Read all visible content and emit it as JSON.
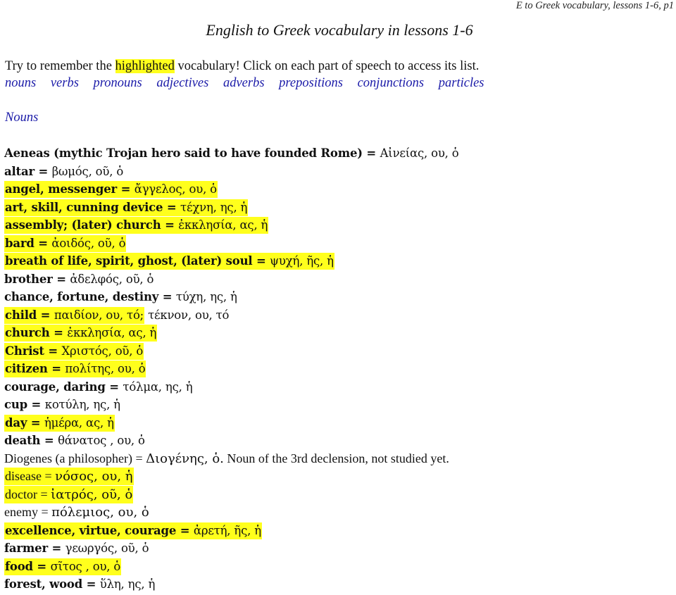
{
  "running_header": "E to Greek vocabulary,  lessons 1-6, p1",
  "title": "English to Greek vocabulary in lessons 1-6",
  "intro": {
    "before": "Try to remember the ",
    "highlighted": "highlighted",
    "after": " vocabulary!  Click on each part of speech to access its list."
  },
  "parts_of_speech": [
    {
      "label": "nouns"
    },
    {
      "label": "verbs"
    },
    {
      "label": "pronouns"
    },
    {
      "label": "adjectives"
    },
    {
      "label": "adverbs"
    },
    {
      "label": "prepositions"
    },
    {
      "label": "conjunctions"
    },
    {
      "label": "particles"
    }
  ],
  "section_heading": "Nouns",
  "highlight_color": "#ffff1c",
  "link_color": "#1a1aa8",
  "entries": [
    {
      "english": "Aeneas (mythic Trojan hero said to have founded Rome) = ",
      "greek": "Αἰνείας, ου, ὁ",
      "rest": "",
      "highlighted": false
    },
    {
      "english": "altar = ",
      "greek": " βωμός, οῦ, ὁ",
      "rest": "",
      "highlighted": false
    },
    {
      "english": "angel, messenger = ",
      "greek": "ἄγγελος, ου, ὁ",
      "rest": "",
      "highlighted": true
    },
    {
      "english": "art, skill, cunning device = ",
      "greek": "τέχνη, ης, ἡ",
      "rest": "",
      "highlighted": true
    },
    {
      "english": "assembly; (later) church = ",
      "greek": "ἐκκλησία, ας, ἡ",
      "rest": "",
      "highlighted": true
    },
    {
      "english": "bard = ",
      "greek": "ἀοιδός, οῦ, ὁ",
      "rest": "",
      "highlighted": true
    },
    {
      "english": "breath of life, spirit, ghost, (later) soul = ",
      "greek": "ψυχή, ῆς, ἡ",
      "rest": "",
      "highlighted": true
    },
    {
      "english": "brother = ",
      "greek": "ἀδελφός, οῦ, ὁ",
      "rest": "",
      "highlighted": false
    },
    {
      "english": "chance, fortune, destiny = ",
      "greek": "τύχη, ης, ἡ",
      "rest": "",
      "highlighted": false
    },
    {
      "english": "child = ",
      "greek": "παιδίον, ου, τό;",
      "rest": " τέκνον, ου, τό",
      "highlighted": true
    },
    {
      "english": "church = ",
      "greek": "ἐκκλησία, ας, ἡ",
      "rest": "",
      "highlighted": true
    },
    {
      "english": "Christ = ",
      "greek": " Χριστός, οῦ, ὁ",
      "rest": "",
      "highlighted": true
    },
    {
      "english": "citizen = ",
      "greek": "πολίτης, ου, ὁ",
      "rest": "",
      "highlighted": true
    },
    {
      "english": "courage, daring = ",
      "greek": "τόλμα, ης, ἡ",
      "rest": "",
      "highlighted": false
    },
    {
      "english": "cup = ",
      "greek": "κοτύλη, ης, ἡ",
      "rest": "",
      "highlighted": false
    },
    {
      "english": "day = ",
      "greek": "ἡμέρα, ας, ἡ",
      "rest": "",
      "highlighted": true
    },
    {
      "english": "death = ",
      "greek": " θάνατος , ου, ὁ",
      "rest": "",
      "highlighted": false
    },
    {
      "english": "Diogenes (a philosopher) = ",
      "greek": "Διογένης, ὁ.",
      "rest": "  Noun of the 3rd declension, not studied yet.",
      "highlighted": false,
      "light": true
    },
    {
      "english": "disease = ",
      "greek": "νόσος, ου, ἡ",
      "rest": "",
      "highlighted": true,
      "light": true
    },
    {
      "english": "doctor = ",
      "greek": " ἰατρός, οῦ, ὁ",
      "rest": "",
      "highlighted": true,
      "light": true
    },
    {
      "english": "enemy = ",
      "greek": "πόλεμιος, ου, ὁ",
      "rest": "",
      "highlighted": false,
      "light": true
    },
    {
      "english": "excellence, virtue, courage = ",
      "greek": "ἀρετή, ῆς, ἡ",
      "rest": "",
      "highlighted": true
    },
    {
      "english": "farmer = ",
      "greek": "γεωργός, οῦ, ὁ",
      "rest": "",
      "highlighted": false
    },
    {
      "english": "food = ",
      "greek": "σῖτος , ου, ὁ",
      "rest": "",
      "highlighted": true
    },
    {
      "english": "forest, wood = ",
      "greek": "ὕλη, ης, ἡ",
      "rest": "",
      "highlighted": false
    }
  ]
}
